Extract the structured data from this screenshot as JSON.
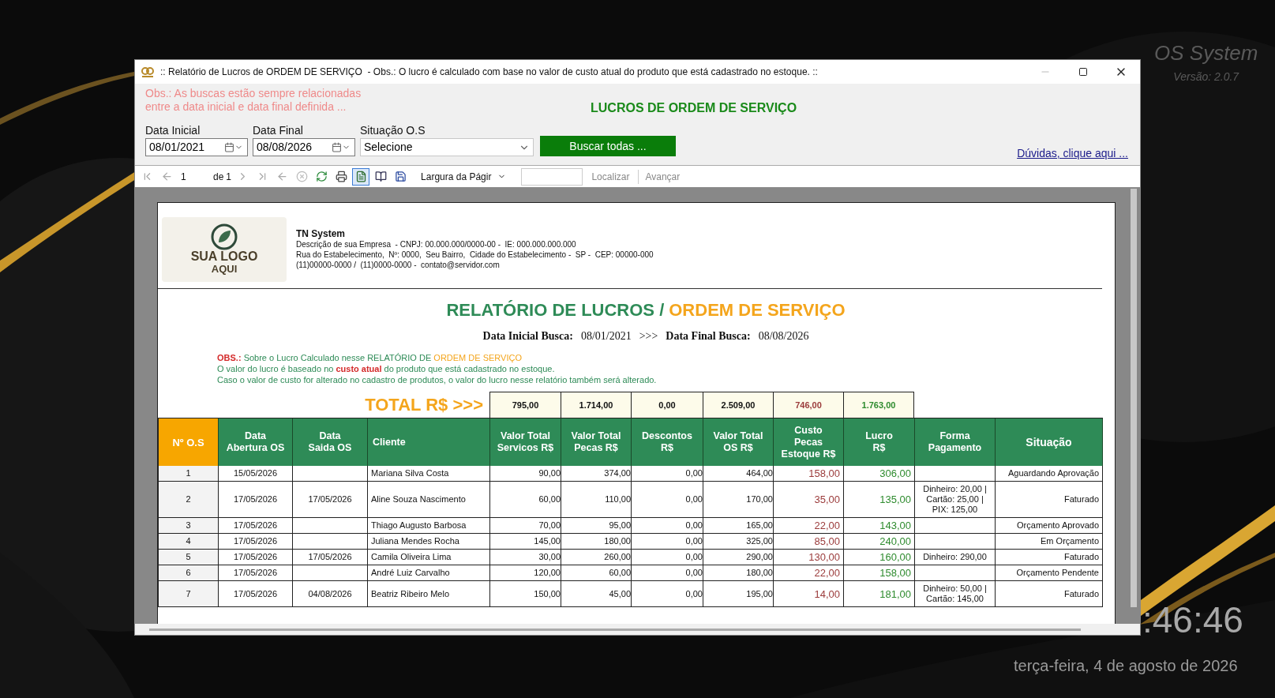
{
  "desktop": {
    "brand": "OS System",
    "version": "Versão: 2.0.7",
    "clock": ":46:46",
    "date": "terça-feira, 4 de agosto de 2026"
  },
  "window": {
    "title": ":: Relatório de Lucros de ORDEM DE SERVIÇO  - Obs.: O lucro é calculado com base no valor de custo atual do produto que está cadastrado no estoque. ::"
  },
  "form": {
    "note": [
      "Obs.: As buscas estão sempre relacionadas",
      "entre a data inicial e data final definida ..."
    ],
    "heading": "LUCROS DE ORDEM DE SERVIÇO",
    "fields": [
      {
        "label": "Data Inicial",
        "value": "08/01/2021",
        "kind": "date"
      },
      {
        "label": "Data Final",
        "value": "08/08/2026",
        "kind": "date"
      },
      {
        "label": "Situação O.S",
        "value": "Selecione",
        "kind": "select"
      }
    ],
    "search_button": "Buscar todas ...",
    "help_link": "Dúvidas, clique aqui ..."
  },
  "toolbar": {
    "page": "1",
    "of": "de",
    "total": "1",
    "zoom": "Largura da Págir",
    "find": "Localizar",
    "next": "Avançar",
    "print_layout_on": true
  },
  "report": {
    "logo": [
      "SUA LOGO",
      "AQUI"
    ],
    "company": "TN System",
    "company_lines": [
      "Descrição de sua Empresa  - CNPJ: 00.000.000/0000-00 -  IE: 000.000.000.000",
      "Rua do Estabelecimento,  Nº: 0000,  Seu Bairro,  Cidade do Estabelecimento -  SP -  CEP: 00000-000",
      "(11)00000-0000 /  (11)0000-0000 -  contato@servidor.com"
    ],
    "title": [
      "RELATÓRIO DE LUCROS /",
      "ORDEM DE SERVIÇO"
    ],
    "range": {
      "start_label": "Data Inicial Busca:",
      "start": "08/01/2021",
      "separator": ">>>",
      "end_label": "Data Final Busca:",
      "end": "08/08/2026"
    },
    "obs": {
      "label": "OBS.:",
      "line1": "Sobre o Lucro Calculado nesse RELATÓRIO DE",
      "line1_highlight": "ORDEM DE SERVIÇO",
      "line2_before": "O valor do lucro é baseado no",
      "line2_highlight": "custo atual",
      "line2_after": "do produto que está cadastrado no estoque.",
      "line3": "Caso o valor de custo for alterado no cadastro de produtos, o valor do lucro nesse relatório também será alterado."
    },
    "total_label": "TOTAL R$ >>>",
    "totals": [
      {
        "value": "795,00",
        "kind": "plain"
      },
      {
        "value": "1.714,00",
        "kind": "plain"
      },
      {
        "value": "0,00",
        "kind": "plain"
      },
      {
        "value": "2.509,00",
        "kind": "plain"
      },
      {
        "value": "746,00",
        "kind": "cost"
      },
      {
        "value": "1.763,00",
        "kind": "profit"
      }
    ],
    "columns": [
      {
        "label": [
          "Nº O.S"
        ],
        "kind": "index"
      },
      {
        "label": [
          "Data",
          "Abertura OS"
        ],
        "kind": "date"
      },
      {
        "label": [
          "Data",
          "Saida OS"
        ],
        "kind": "date"
      },
      {
        "label": [
          "Cliente"
        ],
        "kind": "text"
      },
      {
        "label": [
          "Valor Total",
          "Servicos R$"
        ],
        "kind": "money"
      },
      {
        "label": [
          "Valor Total",
          "Pecas R$"
        ],
        "kind": "money"
      },
      {
        "label": [
          "Descontos",
          "R$"
        ],
        "kind": "money"
      },
      {
        "label": [
          "Valor Total",
          "OS R$"
        ],
        "kind": "money"
      },
      {
        "label": [
          "Custo",
          "Pecas",
          "Estoque R$"
        ],
        "kind": "cost"
      },
      {
        "label": [
          "Lucro",
          "R$"
        ],
        "kind": "profit"
      },
      {
        "label": [
          "Forma",
          "Pagamento"
        ],
        "kind": "payment"
      },
      {
        "label": [
          "Situação"
        ],
        "kind": "status"
      }
    ],
    "rows": [
      {
        "os": "1",
        "opened": "15/05/2026",
        "client": "Mariana Silva Costa",
        "services": "90,00",
        "parts": "374,00",
        "discount": "0,00",
        "total": "464,00",
        "cost": "158,00",
        "profit": "306,00",
        "status": "Aguardando Aprovação"
      },
      {
        "os": "2",
        "opened": "17/05/2026",
        "closed": "17/05/2026",
        "client": "Aline Souza Nascimento",
        "services": "60,00",
        "parts": "110,00",
        "discount": "0,00",
        "total": "170,00",
        "cost": "35,00",
        "profit": "135,00",
        "payment": [
          "Dinheiro: 20,00 |",
          "Cartão: 25,00 |",
          "PIX: 125,00"
        ],
        "status": "Faturado"
      },
      {
        "os": "3",
        "opened": "17/05/2026",
        "client": "Thiago Augusto Barbosa",
        "services": "70,00",
        "parts": "95,00",
        "discount": "0,00",
        "total": "165,00",
        "cost": "22,00",
        "profit": "143,00",
        "status": "Orçamento Aprovado"
      },
      {
        "os": "4",
        "opened": "17/05/2026",
        "client": "Juliana Mendes Rocha",
        "services": "145,00",
        "parts": "180,00",
        "discount": "0,00",
        "total": "325,00",
        "cost": "85,00",
        "profit": "240,00",
        "status": "Em Orçamento"
      },
      {
        "os": "5",
        "opened": "17/05/2026",
        "closed": "17/05/2026",
        "client": "Camila Oliveira Lima",
        "services": "30,00",
        "parts": "260,00",
        "discount": "0,00",
        "total": "290,00",
        "cost": "130,00",
        "profit": "160,00",
        "payment": [
          "Dinheiro: 290,00"
        ],
        "status": "Faturado"
      },
      {
        "os": "6",
        "opened": "17/05/2026",
        "client": "André Luiz Carvalho",
        "services": "120,00",
        "parts": "60,00",
        "discount": "0,00",
        "total": "180,00",
        "cost": "22,00",
        "profit": "158,00",
        "status": "Orçamento Pendente"
      },
      {
        "os": "7",
        "opened": "17/05/2026",
        "closed": "04/08/2026",
        "client": "Beatriz Ribeiro Melo",
        "services": "150,00",
        "parts": "45,00",
        "discount": "0,00",
        "total": "195,00",
        "cost": "14,00",
        "profit": "181,00",
        "payment": [
          "Dinheiro: 50,00 |",
          "Cartão: 145,00"
        ],
        "status": "Faturado"
      }
    ]
  }
}
